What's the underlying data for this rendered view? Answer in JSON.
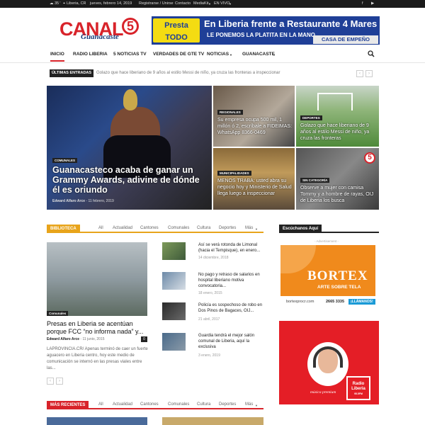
{
  "topbar": {
    "temp": "35",
    "unit": "°",
    "location": "Liberia, CR",
    "date": "jueves, febrero 14, 2019",
    "links": [
      "Registrarse / Unirse",
      "Contacto",
      "MediaKit",
      "EN VIVO"
    ]
  },
  "logo": {
    "text": "CANAL",
    "number": "5",
    "sub": "Guanacaste"
  },
  "banner": {
    "badge_line1": "Presta",
    "badge_line2": "TODO",
    "headline": "En Liberia frente a Restaurante 4 Mares",
    "tagline": "LE PONEMOS LA PLATITA EN LA MANO...",
    "tag": "CASA DE EMPEÑO"
  },
  "nav": {
    "items": [
      "INICIO",
      "RADIO LIBERIA",
      "5 NOTICIAS TV",
      "VERDADES DE GTE TV",
      "NOTICIAS",
      "GUANACASTE"
    ]
  },
  "ticker": {
    "label": "ÚLTIMAS ENTRADAS",
    "text": "Golazo que hace liberiano de 9 años al estilo Messi de niño, ya cruza las fronteras a inspeccionar"
  },
  "featured": [
    {
      "category": "COMUNALES",
      "title": "Guanacasteco acaba de ganar un Grammy Awards, adivine de dónde él es oriundo",
      "author": "Edward Alfaro Arce",
      "date": "11 febrero, 2019"
    },
    {
      "category": "REGIONALES",
      "title": "Su empresa ocupa 500 mil, 1 millón ó 2, escríbale a FIDEIMAS: WhatsApp 8366-0469"
    },
    {
      "category": "DEPORTES",
      "title": "Golazo que hace liberiano de 9 años al estilo Messi de niño, ya cruza las fronteras"
    },
    {
      "category": "MUNICIPALIDADES",
      "title": "MENOS TRABA: usted abra su negocio hoy y Ministerio de Salud llega luego a inspeccionar"
    },
    {
      "category": "SIN CATEGORÍA",
      "title": "Observe a mujer con camisa Tommy y a hombre de rayas, OIJ de Liberia los busca"
    }
  ],
  "biblioteca": {
    "label": "BIBLIOTECA",
    "filters": [
      "All",
      "Actualidad",
      "Cantones",
      "Comunales",
      "Cultura",
      "Deportes",
      "Más"
    ],
    "main": {
      "category": "Comunales",
      "title": "Presas en Liberia se acentúan porque FCC “no informa nada” y...",
      "author": "Edward Alfaro Arce",
      "date": "11 junio, 2015",
      "comments": "0",
      "excerpt": "LAPROVINCIA.CR/ Apenas terminó de caer un fuerte aguacero en Liberia centro, hoy este medio de comunicación se internó en las presas viales entre las..."
    },
    "list": [
      {
        "title": "Así se verá rotonda de Limonal (hacia el Tempisque), en enero...",
        "date": "14 diciembre, 2018"
      },
      {
        "title": "No pago y retraso de salarios en hospital liberiano motiva convocatoria...",
        "date": "18 enero, 2015"
      },
      {
        "title": "Policía es sospechoso de robo en Dos Pinos de Bagaces, OIJ...",
        "date": "21 abril, 2017"
      },
      {
        "title": "Guardia tendrá el mejor salón comunal de Liberia, aquí la exclusiva",
        "date": "3 enero, 2019"
      }
    ]
  },
  "recientes": {
    "label": "MÁS RECIENTES",
    "filters": [
      "All",
      "Actualidad",
      "Cantones",
      "Comunales",
      "Cultura",
      "Deportes",
      "Más"
    ]
  },
  "sidebar": {
    "label": "Escúchanos Aquí",
    "ad_label": "- Advertisement -",
    "bortex": "BORTEX",
    "bortex_sub": "ARTE SOBRE TELA",
    "bortex_url": "bortexprocr.com",
    "bortex_phone": "2665 3335",
    "bortex_cta": "¡LLÁMANOS!",
    "radio_caption": "música premium",
    "radio_logo_1": "Radio",
    "radio_logo_2": "Liberia",
    "radio_logo_3": "95.5FM"
  },
  "colors": {
    "brand": "#d8232a",
    "accent": "#e8a41b",
    "dark": "#222222",
    "banner": "#1f3f97"
  }
}
